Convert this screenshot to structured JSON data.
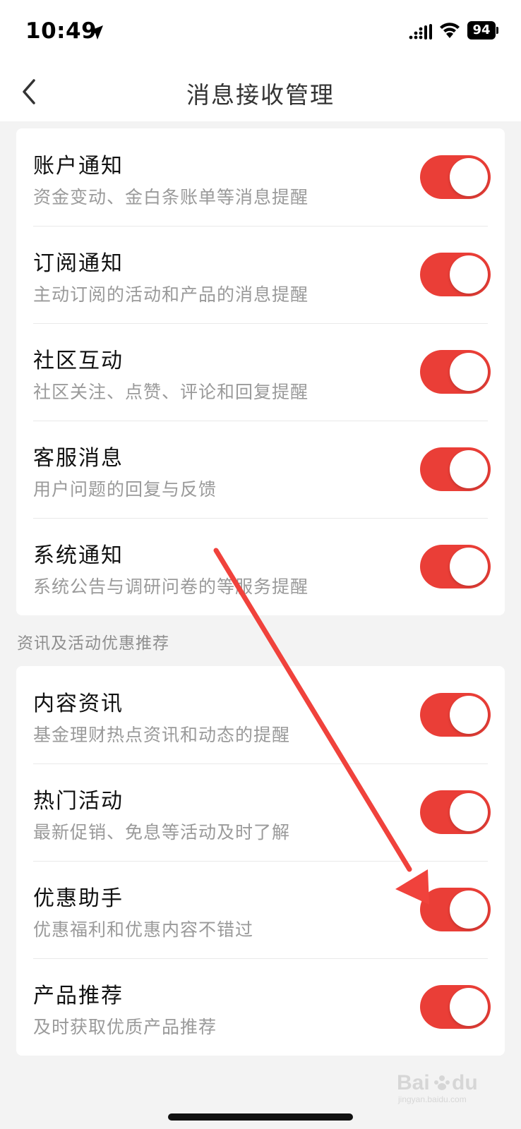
{
  "status_bar": {
    "time": "10:49",
    "battery": "94",
    "icons": [
      "location-arrow-icon",
      "signal-icon",
      "wifi-icon",
      "battery-icon"
    ]
  },
  "nav": {
    "title": "消息接收管理",
    "back_icon": "chevron-left-icon"
  },
  "notifications": {
    "items": [
      {
        "title": "账户通知",
        "desc": "资金变动、金白条账单等消息提醒",
        "enabled": true
      },
      {
        "title": "订阅通知",
        "desc": "主动订阅的活动和产品的消息提醒",
        "enabled": true
      },
      {
        "title": "社区互动",
        "desc": "社区关注、点赞、评论和回复提醒",
        "enabled": true
      },
      {
        "title": "客服消息",
        "desc": "用户问题的回复与反馈",
        "enabled": true
      },
      {
        "title": "系统通知",
        "desc": "系统公告与调研问卷的等服务提醒",
        "enabled": true
      }
    ]
  },
  "promotions": {
    "section_label": "资讯及活动优惠推荐",
    "items": [
      {
        "title": "内容资讯",
        "desc": "基金理财热点资讯和动态的提醒",
        "enabled": true
      },
      {
        "title": "热门活动",
        "desc": "最新促销、免息等活动及时了解",
        "enabled": true
      },
      {
        "title": "优惠助手",
        "desc": "优惠福利和优惠内容不错过",
        "enabled": true
      },
      {
        "title": "产品推荐",
        "desc": "及时获取优质产品推荐",
        "enabled": true
      }
    ]
  },
  "colors": {
    "toggle_on": "#ea3e37",
    "annotation_arrow": "#f0423c",
    "background": "#f3f3f3"
  },
  "watermark": {
    "text": "Baidu经验",
    "sub": "jingyan.baidu.com"
  }
}
